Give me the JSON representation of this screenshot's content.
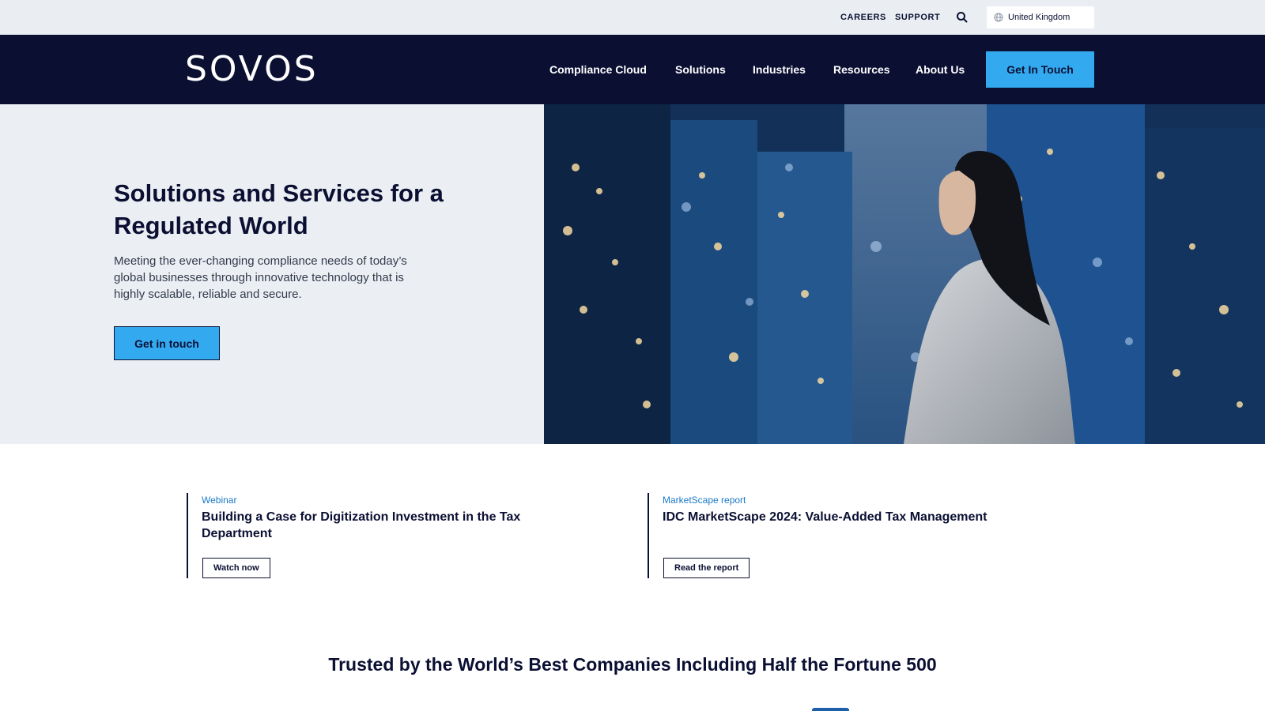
{
  "utility": {
    "careers": "CAREERS",
    "support": "SUPPORT",
    "search_icon": "search-icon",
    "region": "United Kingdom"
  },
  "nav": {
    "logo": "SOVOS",
    "items": [
      "Compliance Cloud",
      "Solutions",
      "Industries",
      "Resources",
      "About Us"
    ],
    "cta": "Get In Touch"
  },
  "hero": {
    "title": "Solutions and Services for a Regulated World",
    "description": "Meeting the ever-changing compliance needs of today’s global businesses through innovative technology that is highly scalable, reliable and secure.",
    "cta": "Get in touch"
  },
  "promos": [
    {
      "tag": "Webinar",
      "title": "Building a Case for Digitization Investment in the Tax Department",
      "button": "Watch now"
    },
    {
      "tag": "MarketScape report",
      "title": "IDC MarketScape 2024: Value-Added Tax Management",
      "button": "Read the report"
    }
  ],
  "trusted": "Trusted by the World’s Best Companies Including Half the Fortune 500",
  "colors": {
    "navy": "#0b1033",
    "accent": "#33a9f0",
    "hero_bg": "#ebeff3",
    "tag_blue": "#1a7ac8"
  }
}
